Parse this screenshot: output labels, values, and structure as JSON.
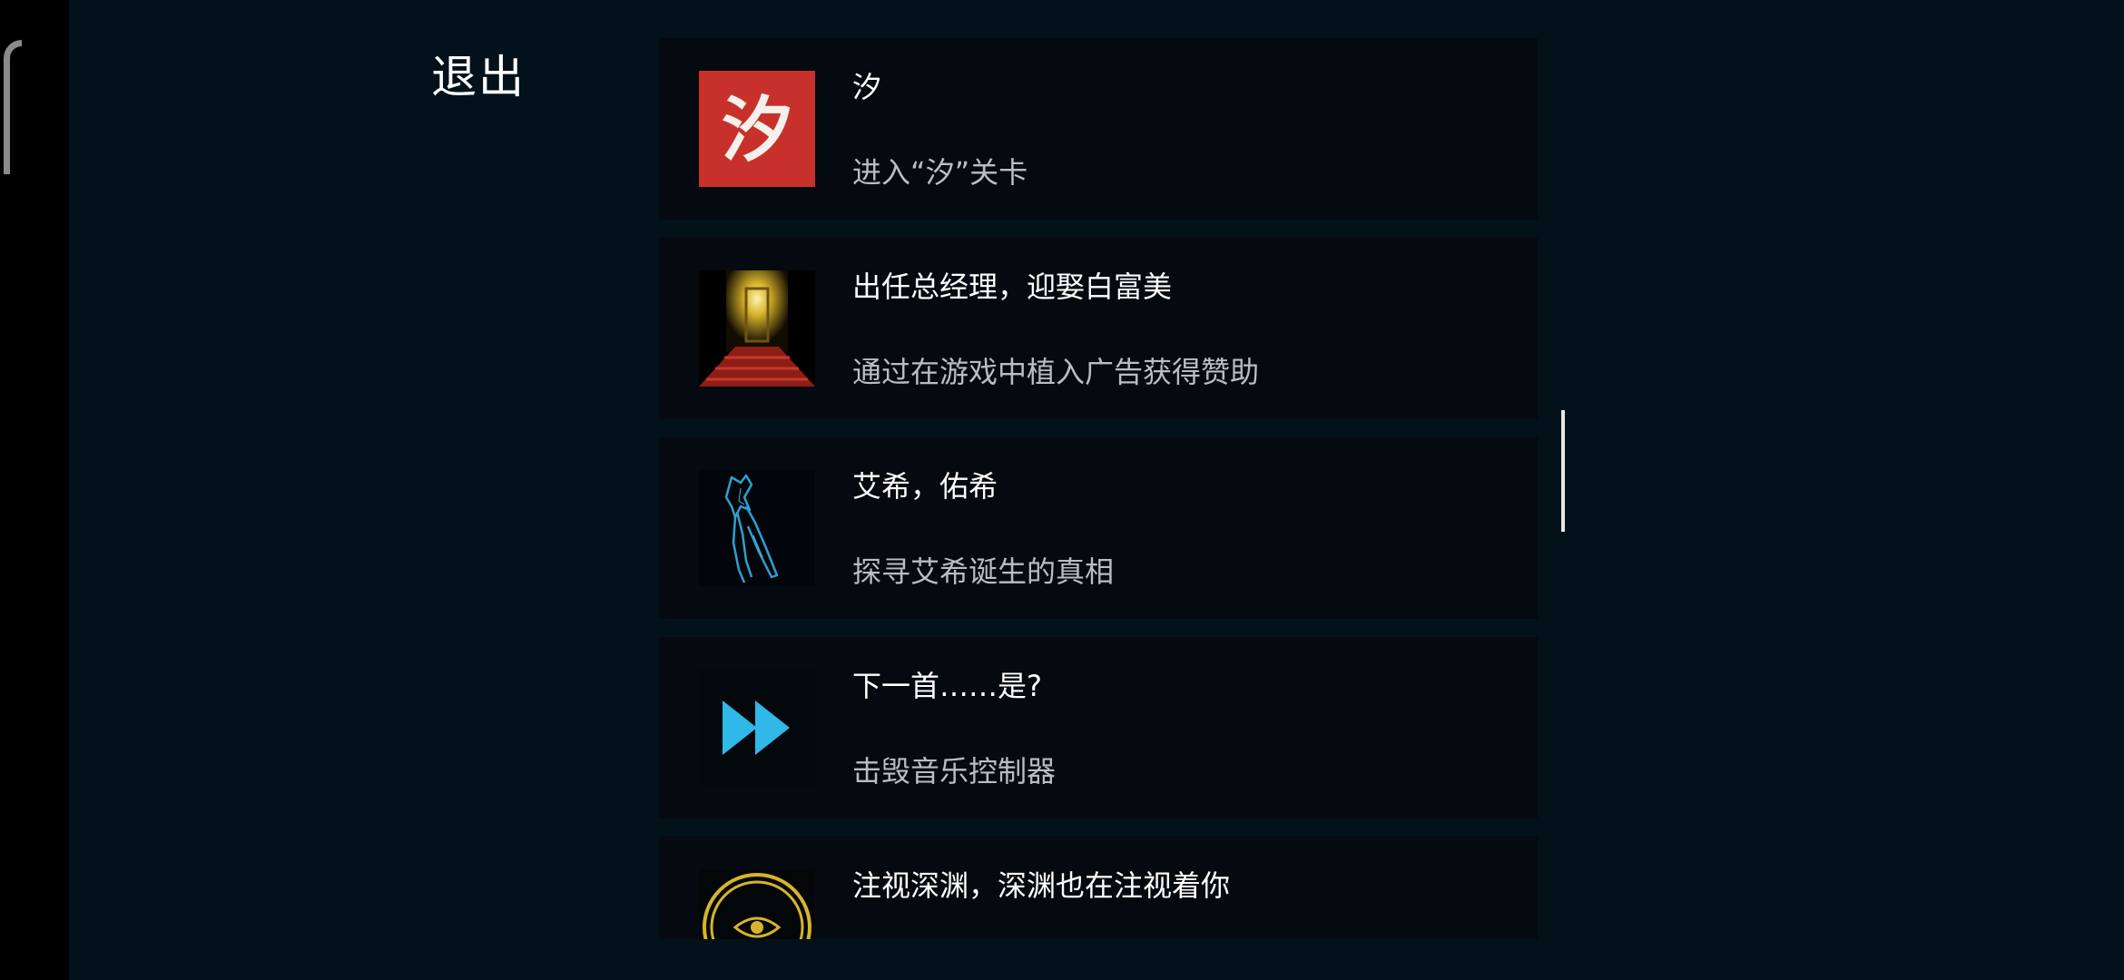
{
  "exit_label": "退出",
  "achievements": [
    {
      "icon": "red-calligraphy-xi-icon",
      "icon_text": "汐",
      "title": "汐",
      "description": "进入“汐”关卡"
    },
    {
      "icon": "red-carpet-golden-door-icon",
      "title": "出任总经理，迎娶白富美",
      "description": "通过在游戏中植入广告获得赞助"
    },
    {
      "icon": "blue-wireframe-sword-figure-icon",
      "title": "艾希，佑希",
      "description": "探寻艾希诞生的真相"
    },
    {
      "icon": "fast-forward-icon",
      "title": "下一首……是?",
      "description": "击毁音乐控制器"
    },
    {
      "icon": "golden-eye-circle-icon",
      "title": "注视深渊，深渊也在注视着你",
      "description": ""
    }
  ],
  "colors": {
    "background": "#02111a",
    "card": "#040a0f",
    "title": "#ffffff",
    "description": "#b9bec2",
    "accent_red": "#c8312b",
    "accent_blue": "#2fb8e8",
    "accent_gold": "#d9b42a"
  }
}
